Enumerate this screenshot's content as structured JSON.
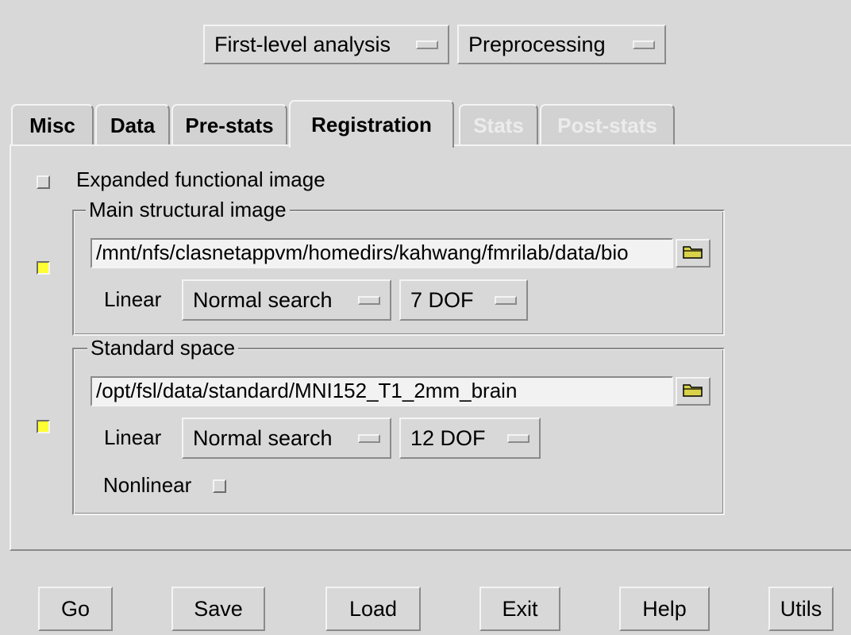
{
  "top_menus": {
    "analysis": "First-level analysis",
    "processing": "Preprocessing"
  },
  "tabs": [
    {
      "label": "Misc",
      "state": "normal"
    },
    {
      "label": "Data",
      "state": "normal"
    },
    {
      "label": "Pre-stats",
      "state": "normal"
    },
    {
      "label": "Registration",
      "state": "active"
    },
    {
      "label": "Stats",
      "state": "disabled"
    },
    {
      "label": "Post-stats",
      "state": "disabled"
    }
  ],
  "registration": {
    "expanded_functional": {
      "label": "Expanded functional image",
      "checked": false
    },
    "main_structural": {
      "title": "Main structural image",
      "checked": true,
      "path": "/mnt/nfs/clasnetappvm/homedirs/kahwang/fmrilab/data/bio",
      "linear_label": "Linear",
      "search": "Normal search",
      "dof": "7 DOF"
    },
    "standard_space": {
      "title": "Standard space",
      "checked": true,
      "path": "/opt/fsl/data/standard/MNI152_T1_2mm_brain",
      "linear_label": "Linear",
      "search": "Normal search",
      "dof": "12 DOF",
      "nonlinear_label": "Nonlinear",
      "nonlinear_checked": false
    }
  },
  "bottom_buttons": {
    "go": "Go",
    "save": "Save",
    "load": "Load",
    "exit": "Exit",
    "help": "Help",
    "utils": "Utils"
  },
  "colors": {
    "background": "#d8d8d8",
    "checkbox_on": "#ffff33",
    "entry_bg": "#f2f2f2",
    "disabled_text": "#ececec"
  },
  "icons": {
    "folder": "folder-icon"
  }
}
